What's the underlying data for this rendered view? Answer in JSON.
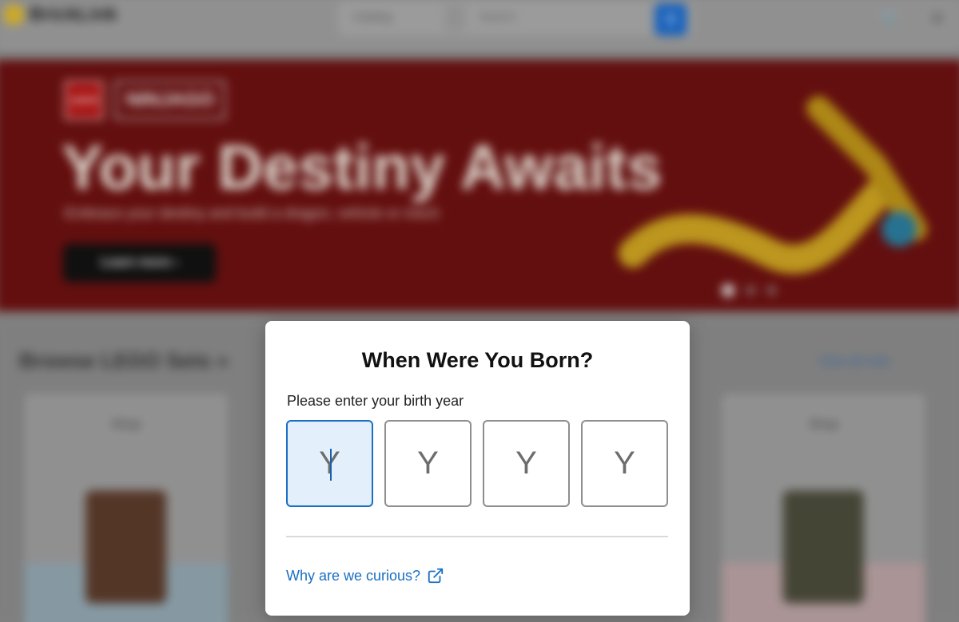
{
  "header": {
    "logo_text": "BrickLink",
    "search_scope": "Catalog",
    "search_placeholder": "Search",
    "search_icon": "search-icon",
    "cart_icon": "cart-icon",
    "user_icon": "user-icon"
  },
  "hero": {
    "brand": "LEGO",
    "theme": "NINJAGO",
    "title": "Your Destiny Awaits",
    "subtitle": "Embrace your destiny and build a dragon, vehicle or mech",
    "cta_label": "Learn more ›",
    "colors": {
      "background": "#6a1010",
      "accent": "#d9b52a"
    }
  },
  "browse": {
    "title": "Browse LEGO Sets »",
    "link": "View all sets",
    "cards": [
      {
        "name": "Shop"
      },
      {
        "name": "Shop"
      }
    ]
  },
  "modal": {
    "title": "When Were You Born?",
    "label": "Please enter your birth year",
    "year_placeholders": [
      "Y",
      "Y",
      "Y",
      "Y"
    ],
    "link_label": "Why are we curious?",
    "link_icon": "external-link-icon",
    "colors": {
      "focus_border": "#1a6fc4",
      "focus_fill": "#e3f0fc",
      "link": "#1a6fc4"
    }
  }
}
